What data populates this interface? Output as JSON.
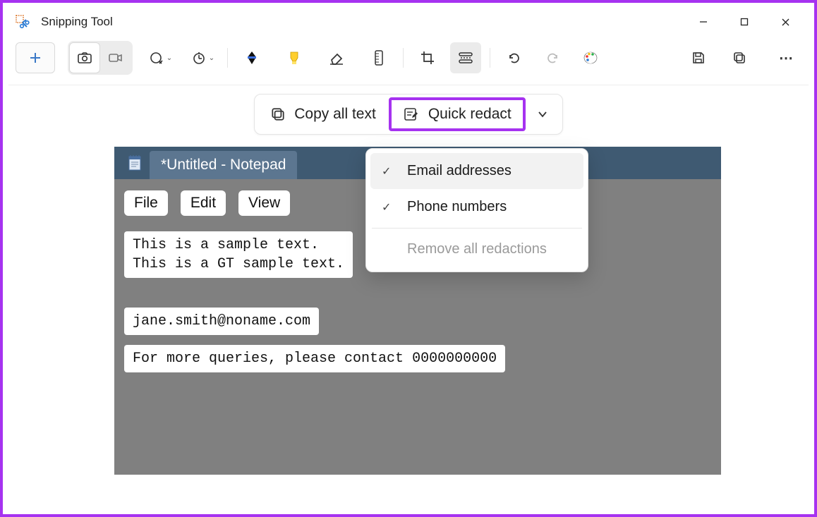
{
  "app": {
    "title": "Snipping Tool"
  },
  "window_controls": {
    "minimize": "—",
    "maximize": "▢",
    "close": "✕"
  },
  "toolbar": {
    "new": "+",
    "more": "⋯"
  },
  "actions": {
    "copy_all_text": "Copy all text",
    "quick_redact": "Quick redact"
  },
  "redact_menu": {
    "email": "Email addresses",
    "phone": "Phone numbers",
    "remove_all": "Remove all redactions"
  },
  "notepad": {
    "tab_title": "*Untitled - Notepad",
    "menus": {
      "file": "File",
      "edit": "Edit",
      "view": "View"
    },
    "block1": "This is a sample text.\nThis is a GT sample text.",
    "block2": "jane.smith@noname.com",
    "block3": "For more queries, please contact 0000000000"
  }
}
